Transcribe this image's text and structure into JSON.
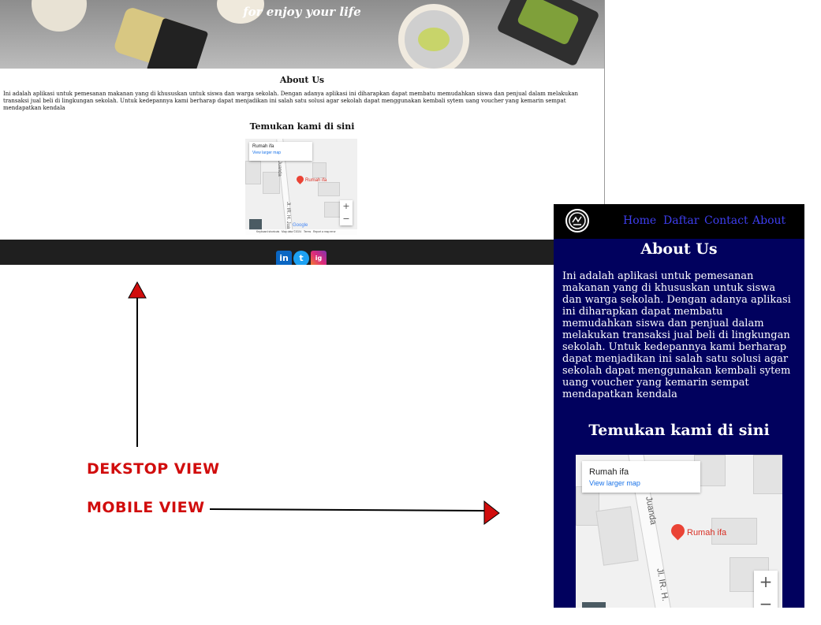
{
  "desktop": {
    "tagline": "for enjoy your life",
    "about_title": "About Us",
    "about_text": "Ini adalah aplikasi untuk pemesanan makanan yang di khususkan untuk siswa dan warga sekolah. Dengan adanya aplikasi ini diharapkan dapat membatu memudahkan siswa dan penjual dalam melakukan transaksi jual beli di lingkungan sekolah. Untuk kedepannya kami berharap dapat menjadikan ini salah satu solusi agar sekolah dapat menggunakan kembali sytem uang voucher yang kemarin sempat mendapatkan kendala",
    "find_title": "Temukan kami di sini",
    "map": {
      "place_name": "Rumah ifa",
      "larger_map_link": "View larger map",
      "pin_label": "Rumah ifa",
      "street_top": "Juanda",
      "street_bottom": "Jl. IR. H. Jua",
      "zoom_in": "+",
      "zoom_out": "−",
      "attribution_shortcuts": "Keyboard shortcuts",
      "attribution_data": "Map data ©2024",
      "attribution_terms": "Terms",
      "attribution_report": "Report a map error",
      "google_logo": "Google"
    },
    "social": [
      "in",
      "t",
      "ig"
    ]
  },
  "mobile": {
    "nav": [
      "Home",
      "Daftar",
      "Contact",
      "About"
    ],
    "about_title": "About Us",
    "about_text": "Ini adalah aplikasi untuk pemesanan makanan yang di khususkan untuk siswa dan warga sekolah. Dengan adanya aplikasi ini diharapkan dapat membatu memudahkan siswa dan penjual dalam melakukan transaksi jual beli di lingkungan sekolah. Untuk kedepannya kami berharap dapat menjadikan ini salah satu solusi agar sekolah dapat menggunakan kembali sytem uang voucher yang kemarin sempat mendapatkan kendala",
    "find_title": "Temukan kami di sini",
    "map": {
      "place_name": "Rumah ifa",
      "larger_map_link": "View larger map",
      "pin_label": "Rumah ifa",
      "street_top": "Juanda",
      "street_bottom": "Jl. IR. H.",
      "zoom_in": "+",
      "zoom_out": "−"
    }
  },
  "annotations": {
    "desktop_label": "DEKSTOP VIEW",
    "mobile_label": "MOBILE VIEW"
  },
  "colors": {
    "mobile_background": "#01015e",
    "nav_link": "#3e3ef0",
    "annotation": "#d10d0d",
    "footer": "#1f1f1f"
  },
  "icons": {
    "social": [
      "linkedin-icon",
      "twitter-icon",
      "instagram-icon"
    ],
    "map_pin": "map-pin-icon",
    "arrows": [
      "arrow-up-icon",
      "arrow-right-icon"
    ]
  }
}
